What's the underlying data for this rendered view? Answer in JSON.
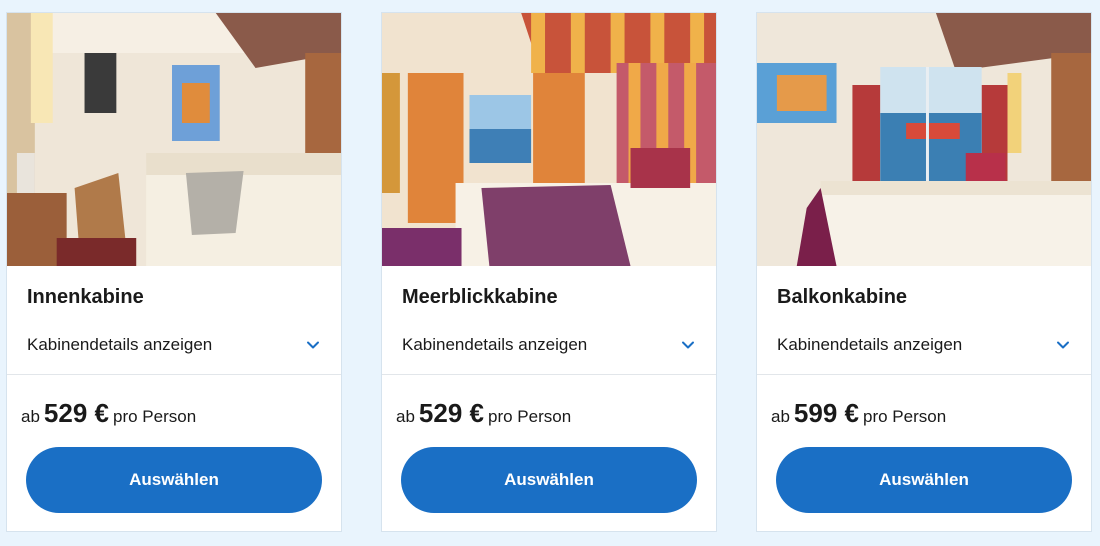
{
  "colors": {
    "page_background": "#e9f4fd",
    "button_primary": "#1a6fc5",
    "chevron": "#1a6fc5"
  },
  "cabins": [
    {
      "image": "inner-cabin-photo",
      "title": "Innenkabine",
      "details_label": "Kabinendetails anzeigen",
      "price_prefix": "ab",
      "price": "529 €",
      "price_suffix": "pro Person",
      "button_label": "Auswählen"
    },
    {
      "image": "sea-view-cabin-photo",
      "title": "Meerblickkabine",
      "details_label": "Kabinendetails anzeigen",
      "price_prefix": "ab",
      "price": "529 €",
      "price_suffix": "pro Person",
      "button_label": "Auswählen"
    },
    {
      "image": "balcony-cabin-photo",
      "title": "Balkonkabine",
      "details_label": "Kabinendetails anzeigen",
      "price_prefix": "ab",
      "price": "599 €",
      "price_suffix": "pro Person",
      "button_label": "Auswählen"
    }
  ]
}
